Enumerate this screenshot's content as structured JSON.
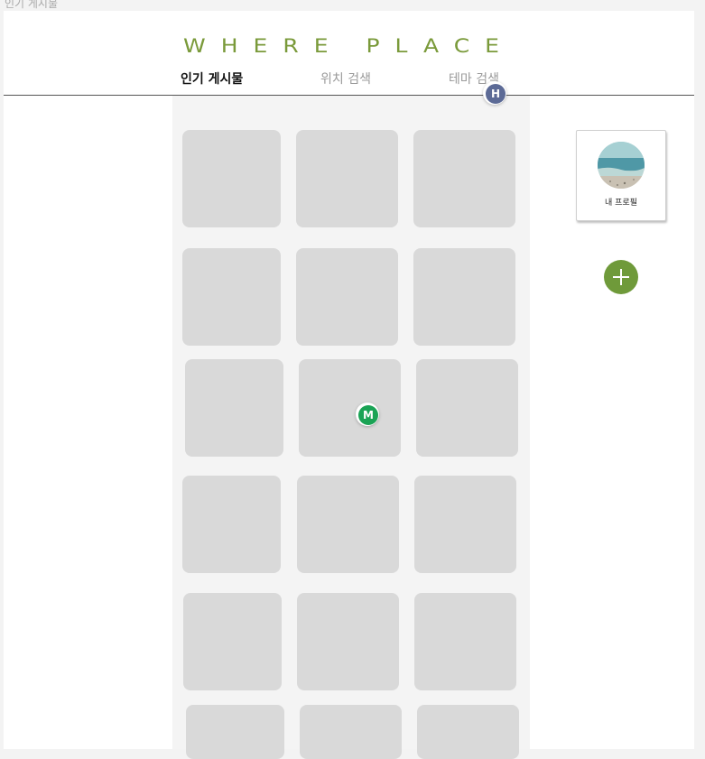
{
  "document_title": "인기 게시물",
  "header": {
    "logo": "WHERE PLACE",
    "tabs": [
      {
        "label": "인기 게시물",
        "active": true
      },
      {
        "label": "위치 검색",
        "active": false
      },
      {
        "label": "테마 검색",
        "active": false
      }
    ]
  },
  "pins": {
    "top": {
      "letter": "H",
      "color": "#5c6a96"
    },
    "feed": {
      "letter": "M",
      "color": "#1aa355"
    }
  },
  "profile_card": {
    "label": "내 프로필"
  },
  "add_button": {
    "icon": "plus-icon",
    "color": "#6f9a3a"
  },
  "feed": {
    "tile_count": 18,
    "tile_color": "#d9d9d9",
    "background": "#f4f4f4"
  }
}
